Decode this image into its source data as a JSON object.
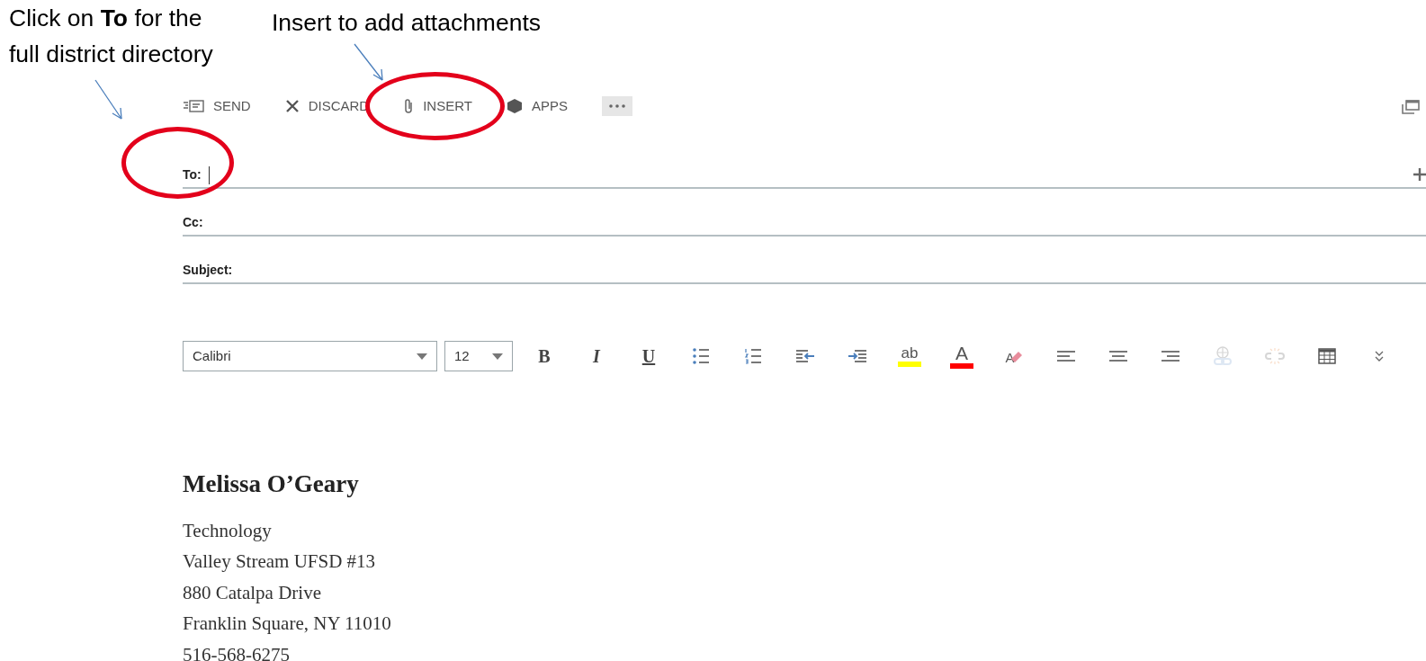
{
  "annotations": [
    {
      "text": "Click on **To** for the\nfull district directory"
    },
    {
      "text": "Insert to add attachments"
    }
  ],
  "toolbar": {
    "actions": [
      {
        "kind": "send",
        "label": "SEND",
        "highlighted": false
      },
      {
        "kind": "discard",
        "label": "DISCARD",
        "highlighted": false
      },
      {
        "kind": "insert",
        "label": "INSERT",
        "highlighted": true
      },
      {
        "kind": "apps",
        "label": "APPS",
        "highlighted": false
      },
      {
        "kind": "more",
        "highlighted": false
      }
    ]
  },
  "fields": [
    {
      "label": "To:",
      "focused": true,
      "add_button": true,
      "highlighted": true
    },
    {
      "label": "Cc:",
      "focused": false,
      "add_button": false,
      "highlighted": false
    },
    {
      "label": "Subject:",
      "focused": false,
      "add_button": false,
      "highlighted": false
    }
  ],
  "format_bar": {
    "font": "Calibri",
    "size": "12",
    "tools": [
      {
        "kind": "bold",
        "label": "B",
        "disabled": false
      },
      {
        "kind": "italic",
        "label": "I",
        "disabled": false
      },
      {
        "kind": "underline",
        "label": "U",
        "disabled": false
      },
      {
        "kind": "bullets",
        "disabled": false
      },
      {
        "kind": "numbering",
        "disabled": false
      },
      {
        "kind": "outdent",
        "disabled": false
      },
      {
        "kind": "indent",
        "disabled": false
      },
      {
        "kind": "highlight",
        "label": "ab",
        "color": "#ffff00",
        "disabled": false
      },
      {
        "kind": "fontcolor",
        "label": "A",
        "color": "#ff0000",
        "disabled": false
      },
      {
        "kind": "clear",
        "label": "A",
        "disabled": false
      },
      {
        "kind": "align-left",
        "disabled": false
      },
      {
        "kind": "align-center",
        "disabled": false
      },
      {
        "kind": "align-right",
        "disabled": false
      },
      {
        "kind": "link",
        "disabled": true
      },
      {
        "kind": "unlink",
        "disabled": true
      },
      {
        "kind": "table",
        "disabled": false
      },
      {
        "kind": "expand",
        "disabled": false
      }
    ]
  },
  "signature": {
    "name": "Melissa O’Geary",
    "lines": [
      "Technology",
      "Valley Stream UFSD #13",
      "880 Catalpa Drive",
      "Franklin Square, NY 11010",
      "516-568-6275"
    ]
  }
}
